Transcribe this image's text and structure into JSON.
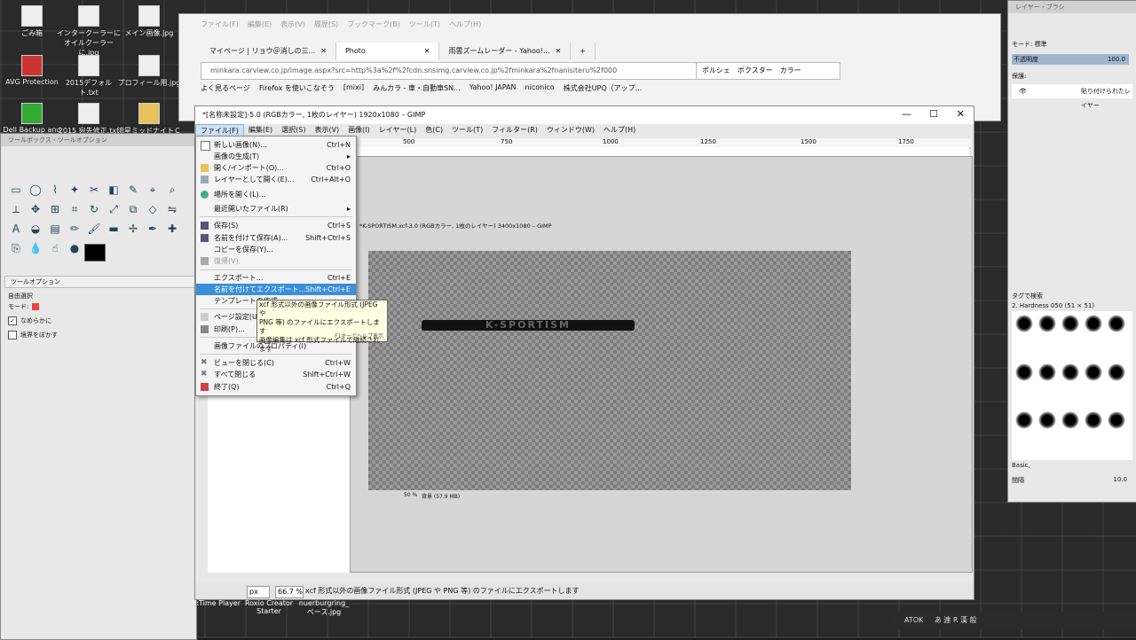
{
  "desktop": {
    "icons": [
      {
        "label": "ごみ箱"
      },
      {
        "label": "インタークーラーにオイルクーラーに.jpg"
      },
      {
        "label": "メイン画像.jpg"
      },
      {
        "label": "AVG Protection"
      },
      {
        "label": "2015デフォルト.txt"
      },
      {
        "label": "プロフィール用.jpg"
      },
      {
        "label": "Dell Backup and"
      },
      {
        "label": "2015 宛先修正.txt"
      },
      {
        "label": "流星ミッドナイトＣ"
      }
    ],
    "bottom_icons": [
      {
        "label": "ckTime Player"
      },
      {
        "label": "Roxio Creator Starter"
      },
      {
        "label": "nuerburgring_ベース.jpg"
      }
    ]
  },
  "browser": {
    "menu": [
      "ファイル(F)",
      "編集(E)",
      "表示(V)",
      "履歴(S)",
      "ブックマーク(B)",
      "ツール(T)",
      "ヘルプ(H)"
    ],
    "tabs": [
      {
        "label": "マイページ | リョウ＠消しの三..."
      },
      {
        "label": "Photo"
      },
      {
        "label": "雨雲ズームレーダー - Yahoo!..."
      }
    ],
    "url": "minkara.carview.co.jp/image.aspx?src=http%3a%2f%2fcdn.snsimg.carview.co.jp%2fminkara%2fnanisiteru%2f000",
    "search": "ポルシェ　ボクスター　カラー",
    "bookmarks": [
      "よく見るページ",
      "Firefox を使いこなそう",
      "[mixi]",
      "みんカラ - 車・自動車SN...",
      "Yahoo! JAPAN",
      "niconico",
      "株式会社UPQ（アップ..."
    ]
  },
  "gimp": {
    "title": "*[名称未設定]-5.0 (RGBカラー, 1枚のレイヤー) 1920x1080 – GIMP",
    "menu": [
      "ファイル(F)",
      "編集(E)",
      "選択(S)",
      "表示(V)",
      "画像(I)",
      "レイヤー(L)",
      "色(C)",
      "ツール(T)",
      "フィルター(R)",
      "ウィンドウ(W)",
      "ヘルプ(H)"
    ],
    "ruler": [
      "500",
      "750",
      "1000",
      "1250",
      "1500",
      "1750"
    ],
    "status_unit": "px",
    "status_zoom": "66.7 %",
    "status_text": "xcf 形式以外の画像ファイル形式 (JPEG や PNG 等) のファイルにエクスポートします"
  },
  "inner": {
    "title": "*K-SPORTISM.xcf-3.0 (RGBカラー, 1枚のレイヤー) 3400x1080 – GIMP",
    "logo": "K-SPORTISM",
    "zoom": "50 %",
    "status": "背景 (57.9 MB)"
  },
  "file_menu": {
    "items": [
      {
        "label": "新しい画像(N)...",
        "shortcut": "Ctrl+N"
      },
      {
        "label": "画像の生成(T)",
        "shortcut": "▸"
      },
      {
        "label": "開く/インポート(O)...",
        "shortcut": "Ctrl+O"
      },
      {
        "label": "レイヤーとして開く(E)...",
        "shortcut": "Ctrl+Alt+O"
      },
      {
        "label": "場所を開く(L)...",
        "shortcut": ""
      },
      {
        "label": "最近開いたファイル(R)",
        "shortcut": "▸"
      },
      {
        "label": "保存(S)",
        "shortcut": "Ctrl+S"
      },
      {
        "label": "名前を付けて保存(A)...",
        "shortcut": "Shift+Ctrl+S"
      },
      {
        "label": "コピーを保存(Y)...",
        "shortcut": ""
      },
      {
        "label": "復帰(V)",
        "shortcut": ""
      },
      {
        "label": "エクスポート...",
        "shortcut": "Ctrl+E"
      },
      {
        "label": "名前を付けてエクスポート...",
        "shortcut": "Shift+Ctrl+E"
      },
      {
        "label": "テンプレートの作成...",
        "shortcut": ""
      },
      {
        "label": "ページ設定(U)",
        "shortcut": ""
      },
      {
        "label": "印刷(P)...",
        "shortcut": ""
      },
      {
        "label": "画像ファイルのプロパティ(I)",
        "shortcut": ""
      },
      {
        "label": "ビューを閉じる(C)",
        "shortcut": "Ctrl+W"
      },
      {
        "label": "すべて閉じる",
        "shortcut": "Shift+Ctrl+W"
      },
      {
        "label": "終了(Q)",
        "shortcut": "Ctrl+Q"
      }
    ]
  },
  "tooltip": {
    "text1": "xcf 形式以外の画像ファイル形式 (JPEG や",
    "text2": "PNG 等) のファイルにエクスポートします",
    "text3": "画像編集は xcf 形式ファイルで継続されます",
    "hint": "F1キーでヘルプ表示"
  },
  "toolbox": {
    "title": "ツールボックス - ツールオプション",
    "options_tab": "ツールオプション",
    "tool_name": "自由選択",
    "mode_label": "モード:",
    "antialias": "なめらかに",
    "feather": "境界をぼかす"
  },
  "layers": {
    "title": "レイヤー・ブラシ",
    "mode_label": "モード:",
    "mode_value": "標準",
    "opacity_label": "不透明度",
    "opacity_value": "100.0",
    "lock_label": "保護:",
    "layer_name": "貼り付けられたレイヤー",
    "brush_tag": "タグで検索",
    "brush_name": "2. Hardness 050 (51 × 51)",
    "preset": "Basic,",
    "spacing_label": "間隔",
    "spacing_value": "10.0"
  },
  "taskbar": {
    "ime": "ATOK",
    "label": "あ 連 R 漢 般"
  }
}
